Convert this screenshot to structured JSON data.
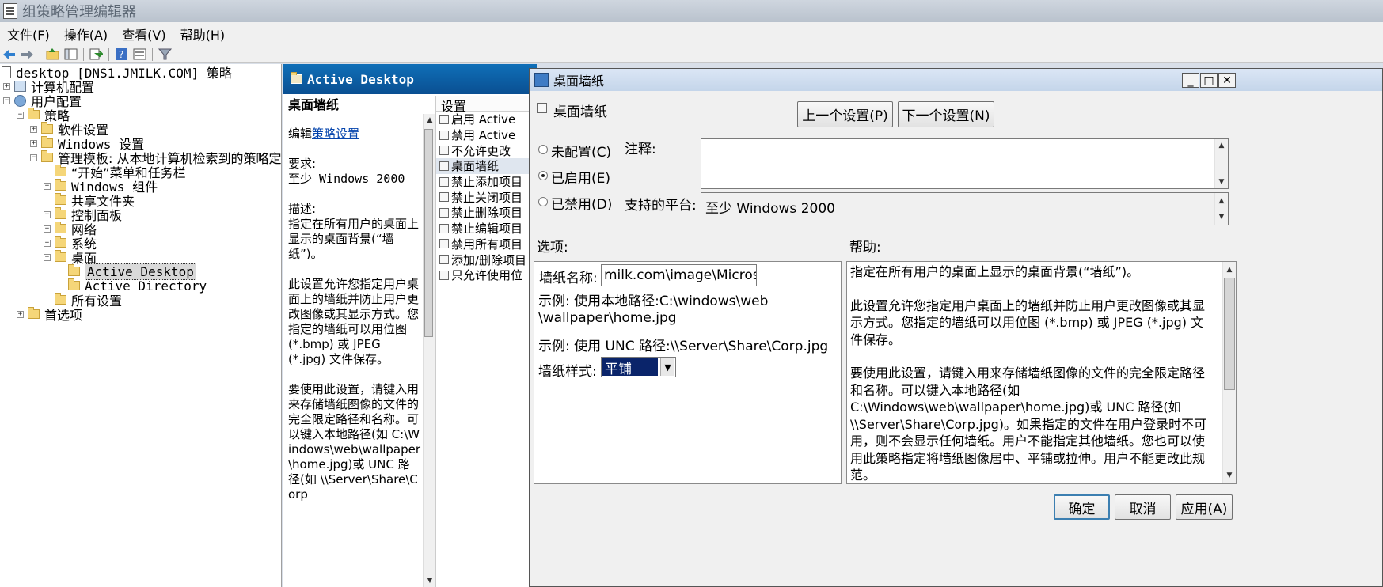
{
  "window": {
    "title": "组策略管理编辑器"
  },
  "menu": [
    "文件(F)",
    "操作(A)",
    "查看(V)",
    "帮助(H)"
  ],
  "toolbar": [
    "back-icon",
    "forward-icon",
    "up-icon",
    "show-hide-tree-icon",
    "export-icon",
    "help-icon",
    "view-icon",
    "filter-icon"
  ],
  "tree": {
    "root": "desktop [DNS1.JMILK.COM] 策略",
    "computer": "计算机配置",
    "user": "用户配置",
    "policies": "策略",
    "software": "软件设置",
    "windows_settings": "Windows 设置",
    "admin_templates": "管理模板: 从本地计算机检索到的策略定义",
    "start_menu": "“开始”菜单和任务栏",
    "windows_components": "Windows 组件",
    "shared_folders": "共享文件夹",
    "control_panel": "控制面板",
    "network": "网络",
    "system": "系统",
    "desktop": "桌面",
    "active_desktop": "Active Desktop",
    "active_directory": "Active Directory",
    "all_settings": "所有设置",
    "preferences": "首选项"
  },
  "middle": {
    "header": "Active Desktop",
    "title": "桌面墙纸",
    "edit_prefix": "编辑",
    "edit_link": "策略设置",
    "req_label": "要求:",
    "req_value": "至少 Windows 2000",
    "desc_label": "描述:",
    "desc_value": "指定在所有用户的桌面上显示的桌面背景(“墙纸”)。",
    "para2": "此设置允许您指定用户桌面上的墙纸并防止用户更改图像或其显示方式。您指定的墙纸可以用位图 (*.bmp) 或 JPEG (*.jpg) 文件保存。",
    "para3": "要使用此设置，请键入用来存储墙纸图像的文件的完全限定路径和名称。可以键入本地路径(如 C:\\Windows\\web\\wallpaper\\home.jpg)或 UNC 路径(如 \\\\Server\\Share\\Corp",
    "settings_header": "设置",
    "settings": [
      "启用 Active",
      "禁用 Active",
      "不允许更改",
      "桌面墙纸",
      "禁止添加项目",
      "禁止关闭项目",
      "禁止删除项目",
      "禁止编辑项目",
      "禁用所有项目",
      "添加/删除项目",
      "只允许使用位"
    ]
  },
  "dialog": {
    "title": "桌面墙纸",
    "setting_name": "桌面墙纸",
    "prev_btn": "上一个设置(P)",
    "next_btn": "下一个设置(N)",
    "not_configured": "未配置(C)",
    "enabled": "已启用(E)",
    "disabled": "已禁用(D)",
    "comment_label": "注释:",
    "comment_value": "",
    "platform_label": "支持的平台:",
    "platform_value": "至少 Windows 2000",
    "options_label": "选项:",
    "help_label": "帮助:",
    "wallpaper_name_label": "墙纸名称:",
    "wallpaper_name_value": "milk.com\\image\\Microsoft",
    "example1": "示例: 使用本地路径:C:\\windows\\web\\wallpaper\\home.jpg",
    "example2": "示例: 使用 UNC 路径:\\\\Server\\Share\\Corp.jpg",
    "style_label": "墙纸样式:",
    "style_value": "平铺",
    "help_p1": "指定在所有用户的桌面上显示的桌面背景(“墙纸”)。",
    "help_p2": "此设置允许您指定用户桌面上的墙纸并防止用户更改图像或其显示方式。您指定的墙纸可以用位图 (*.bmp) 或 JPEG (*.jpg) 文件保存。",
    "help_p3": "要使用此设置，请键入用来存储墙纸图像的文件的完全限定路径和名称。可以键入本地路径(如 C:\\Windows\\web\\wallpaper\\home.jpg)或 UNC 路径(如 \\\\Server\\Share\\Corp.jpg)。如果指定的文件在用户登录时不可用，则不会显示任何墙纸。用户不能指定其他墙纸。您也可以使用此策略指定将墙纸图像居中、平铺或拉伸。用户不能更改此规范。",
    "ok_btn": "确定",
    "cancel_btn": "取消",
    "apply_btn": "应用(A)"
  }
}
